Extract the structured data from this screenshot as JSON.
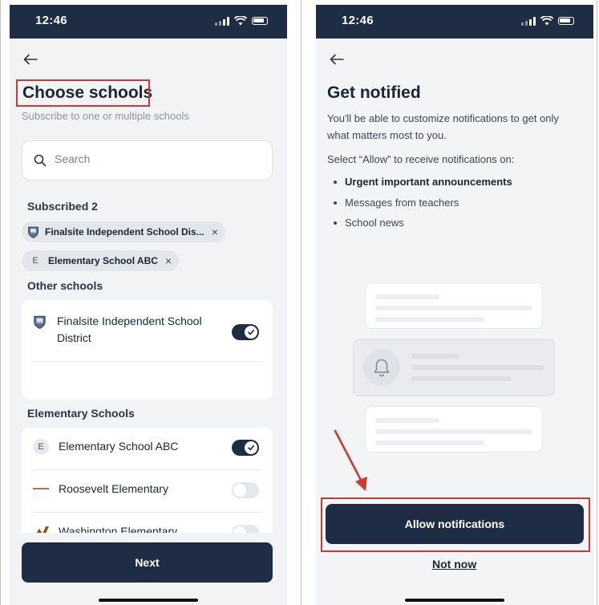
{
  "left_screen": {
    "status": {
      "time": "12:46"
    },
    "title": "Choose schools",
    "subtitle": "Subscribe to one or multiple schools",
    "search": {
      "placeholder": "Search"
    },
    "subscribed_label": "Subscribed 2",
    "chips": [
      {
        "label": "Finalsite Independent School Dis...",
        "icon": "school-crest-icon",
        "remove": "×"
      },
      {
        "label": "Elementary School ABC",
        "badge": "E",
        "remove": "×"
      }
    ],
    "other_label": "Other schools",
    "other_schools": [
      {
        "name": "Finalsite Independent School District",
        "icon": "school-crest-icon",
        "subscribed": true
      }
    ],
    "elementary_label": "Elementary Schools",
    "elementary_schools": [
      {
        "name": "Elementary School ABC",
        "badge": "E",
        "subscribed": true
      },
      {
        "name": "Roosevelt Elementary",
        "subscribed": false
      },
      {
        "name": "Washington Elementary",
        "subscribed": false
      }
    ],
    "next_label": "Next"
  },
  "right_screen": {
    "status": {
      "time": "12:46"
    },
    "title": "Get notified",
    "intro": "You'll be able to customize notifications to get only what matters most to you.",
    "select_text": "Select “Allow” to receive notifications on:",
    "bullets": [
      {
        "text": "Urgent important announcements",
        "bold": true
      },
      {
        "text": "Messages from teachers",
        "bold": false
      },
      {
        "text": "School news",
        "bold": false
      }
    ],
    "allow_label": "Allow notifications",
    "not_now_label": "Not now"
  },
  "colors": {
    "navy": "#1e2d44",
    "highlight": "#cc3a33",
    "background": "#f2f3f5"
  }
}
